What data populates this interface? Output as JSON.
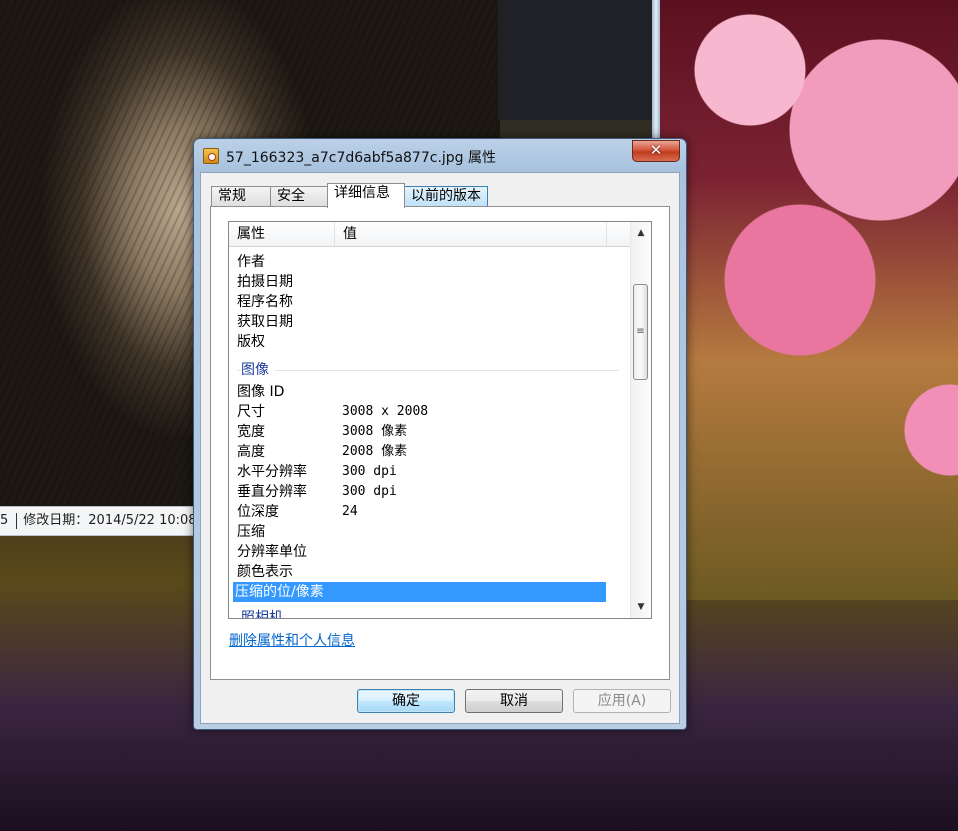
{
  "background": {
    "status_text": "修改日期：2014/5/22 10:08",
    "status_prefix": "5"
  },
  "dialog": {
    "title": "57_166323_a7c7d6abf5a877c.jpg 属性",
    "close_label": "✕",
    "tabs": [
      {
        "label": "常规"
      },
      {
        "label": "安全"
      },
      {
        "label": "详细信息"
      },
      {
        "label": "以前的版本"
      }
    ],
    "list": {
      "header_property": "属性",
      "header_value": "值",
      "rows_top": [
        {
          "prop": "作者",
          "val": ""
        },
        {
          "prop": "拍摄日期",
          "val": ""
        },
        {
          "prop": "程序名称",
          "val": ""
        },
        {
          "prop": "获取日期",
          "val": ""
        },
        {
          "prop": "版权",
          "val": ""
        }
      ],
      "group_image": "图像",
      "rows_image": [
        {
          "prop": "图像 ID",
          "val": ""
        },
        {
          "prop": "尺寸",
          "val": "3008 x 2008"
        },
        {
          "prop": "宽度",
          "val": "3008 像素"
        },
        {
          "prop": "高度",
          "val": "2008 像素"
        },
        {
          "prop": "水平分辨率",
          "val": "300 dpi"
        },
        {
          "prop": "垂直分辨率",
          "val": "300 dpi"
        },
        {
          "prop": "位深度",
          "val": "24"
        },
        {
          "prop": "压缩",
          "val": ""
        },
        {
          "prop": "分辨率单位",
          "val": ""
        },
        {
          "prop": "颜色表示",
          "val": ""
        },
        {
          "prop": "压缩的位/像素",
          "val": ""
        }
      ],
      "group_camera": "照相机",
      "selected_row": "压缩的位/像素"
    },
    "remove_link": "删除属性和个人信息",
    "buttons": {
      "ok": "确定",
      "cancel": "取消",
      "apply": "应用(A)"
    }
  }
}
